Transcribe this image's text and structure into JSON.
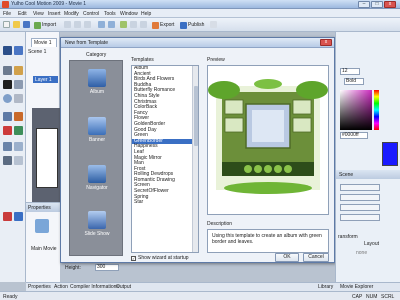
{
  "window": {
    "title": "Yulho Cool Motion 2009 - Movie 1",
    "minimize": "–",
    "maximize": "□",
    "close": "x"
  },
  "menu": [
    "File",
    "Edit",
    "View",
    "Insert",
    "Modify",
    "Control",
    "Tools",
    "Window",
    "Help"
  ],
  "toolbar": {
    "import_label": "Import",
    "export_label": "Export",
    "publish_label": "Publish"
  },
  "scene": {
    "tab_label": "Movie 1",
    "scene_label": "Scene 1",
    "layer_label": "Layer 1"
  },
  "properties": {
    "header": "Properties",
    "main_movie": "Main Movie",
    "height_label": "Height:",
    "height_value": "300"
  },
  "dialog": {
    "title": "New from Template",
    "category_label": "Category",
    "categories": [
      "Album",
      "Banner",
      "Navigator",
      "Slide Show"
    ],
    "templates_label": "Templates",
    "templates": [
      "Album",
      "Ancient",
      "Birds And Flowers",
      "Buddha",
      "Butterfly Romance",
      "China Style",
      "Christmas",
      "ColorBack",
      "Fancy",
      "Flower",
      "GoldenBorder",
      "Good Day",
      "Green",
      "GreenBorder",
      "Happiness",
      "Leaf",
      "Magic Mirror",
      "Man",
      "Frost",
      "Rolling Dewdrops",
      "Romantic Drawing",
      "Screen",
      "SecretOfFlower",
      "Spring",
      "Star"
    ],
    "selected_template": "GreenBorder",
    "preview_label": "Preview",
    "description_label": "Description",
    "description_text": "Using this template to create an album with green border and leaves.",
    "show_wizard": "Show wizard at startup",
    "ok": "OK",
    "cancel": "Cancel"
  },
  "right_panel": {
    "font_size": "12",
    "font_weight": "Bold",
    "hex_color": "#0000ff",
    "scene_header": "Scene",
    "transform_header": "ransform",
    "layout": "Layout",
    "none": "none"
  },
  "bottom_tabs": [
    "Properties",
    "Action",
    "Compiler Informations",
    "Output",
    "Library",
    "Movie Explorer"
  ],
  "status": {
    "left": "Ready",
    "caps": "CAP",
    "num": "NUM",
    "scrl": "SCRL"
  },
  "colors": {
    "accent": "#3a6fc4",
    "swatch": "#1a1aff"
  }
}
